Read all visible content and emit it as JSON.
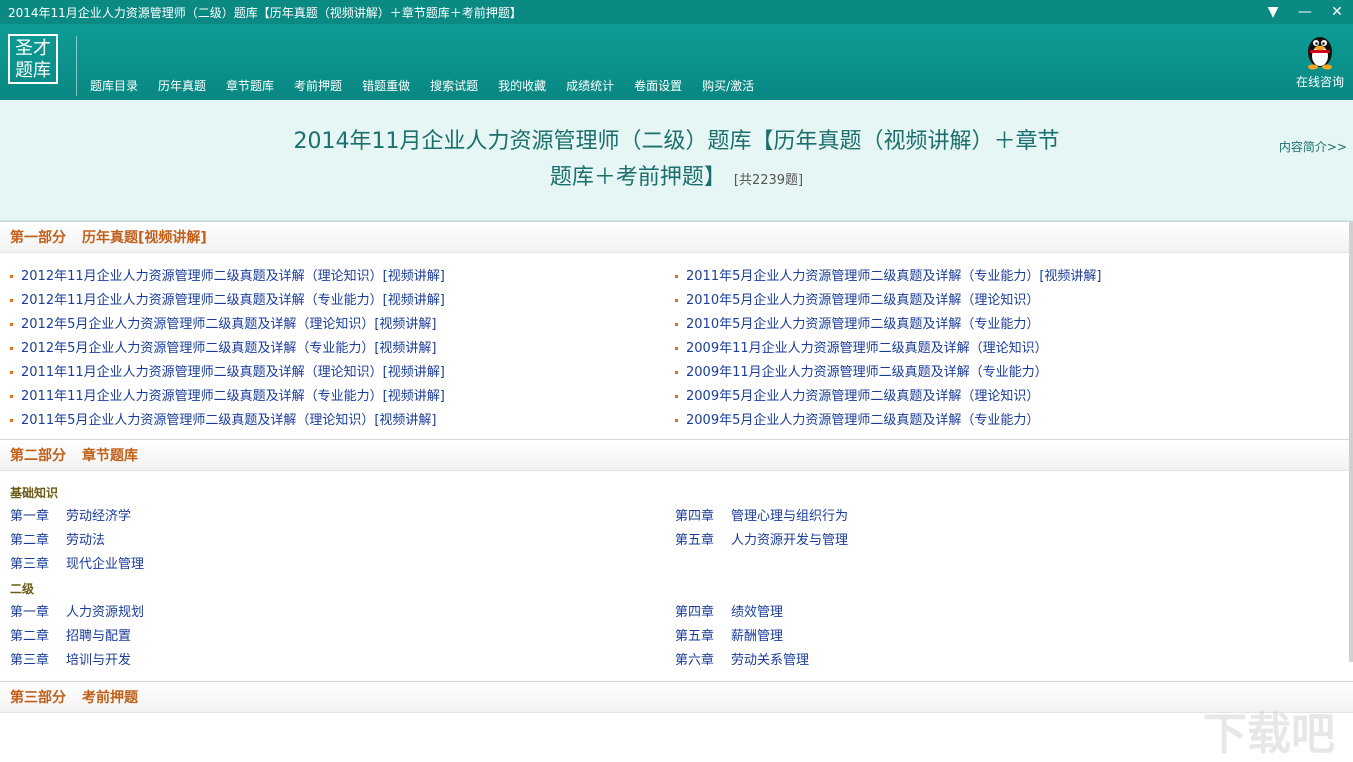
{
  "window": {
    "title": "2014年11月企业人力资源管理师（二级）题库【历年真题（视频讲解）＋章节题库＋考前押题】",
    "controls": [
      "▼",
      "—",
      "✕"
    ]
  },
  "header": {
    "logo": [
      "圣才",
      "题库"
    ],
    "nav": [
      "题库目录",
      "历年真题",
      "章节题库",
      "考前押题",
      "错题重做",
      "搜索试题",
      "我的收藏",
      "成绩统计",
      "卷面设置",
      "购买/激活"
    ],
    "consult_label": "在线咨询"
  },
  "banner": {
    "title_line1": "2014年11月企业人力资源管理师（二级）题库【历年真题（视频讲解）＋章节",
    "title_line2": "题库＋考前押题】",
    "count": "[共2239题]",
    "intro_link": "内容简介>>"
  },
  "sections": [
    {
      "part": "第一部分",
      "name": "历年真题[视频讲解]",
      "left": [
        "2012年11月企业人力资源管理师二级真题及详解（理论知识）[视频讲解]",
        "2012年11月企业人力资源管理师二级真题及详解（专业能力）[视频讲解]",
        "2012年5月企业人力资源管理师二级真题及详解（理论知识）[视频讲解]",
        "2012年5月企业人力资源管理师二级真题及详解（专业能力）[视频讲解]",
        "2011年11月企业人力资源管理师二级真题及详解（理论知识）[视频讲解]",
        "2011年11月企业人力资源管理师二级真题及详解（专业能力）[视频讲解]",
        "2011年5月企业人力资源管理师二级真题及详解（理论知识）[视频讲解]"
      ],
      "right": [
        "2011年5月企业人力资源管理师二级真题及详解（专业能力）[视频讲解]",
        "2010年5月企业人力资源管理师二级真题及详解（理论知识）",
        "2010年5月企业人力资源管理师二级真题及详解（专业能力）",
        "2009年11月企业人力资源管理师二级真题及详解（理论知识）",
        "2009年11月企业人力资源管理师二级真题及详解（专业能力）",
        "2009年5月企业人力资源管理师二级真题及详解（理论知识）",
        "2009年5月企业人力资源管理师二级真题及详解（专业能力）"
      ]
    },
    {
      "part": "第二部分",
      "name": "章节题库",
      "groups": [
        {
          "label": "基础知识",
          "left": [
            [
              "第一章",
              "劳动经济学"
            ],
            [
              "第二章",
              "劳动法"
            ],
            [
              "第三章",
              "现代企业管理"
            ]
          ],
          "right": [
            [
              "第四章",
              "管理心理与组织行为"
            ],
            [
              "第五章",
              "人力资源开发与管理"
            ]
          ]
        },
        {
          "label": "二级",
          "left": [
            [
              "第一章",
              "人力资源规划"
            ],
            [
              "第二章",
              "招聘与配置"
            ],
            [
              "第三章",
              "培训与开发"
            ]
          ],
          "right": [
            [
              "第四章",
              "绩效管理"
            ],
            [
              "第五章",
              "薪酬管理"
            ],
            [
              "第六章",
              "劳动关系管理"
            ]
          ]
        }
      ]
    },
    {
      "part": "第三部分",
      "name": "考前押题"
    }
  ],
  "watermark": "下载吧"
}
